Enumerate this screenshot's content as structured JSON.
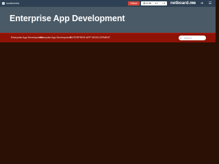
{
  "topbar": {
    "brand": "socialmedia",
    "follow_label": "Follow",
    "stats": {
      "views": "41.6k",
      "likes": "1",
      "shares": "4"
    },
    "site_brand": "netboard.me"
  },
  "header": {
    "title": "Enterprise App Development"
  },
  "nav": {
    "items": [
      {
        "label": "Enterprise App Development"
      },
      {
        "label": "Enterprise App Development"
      },
      {
        "label": "ENTERPRISE APP DEVELOPMENT"
      }
    ],
    "search_placeholder": "Search"
  },
  "colors": {
    "topbar": "#2e4154",
    "header": "#4a5a66",
    "navbar": "#8e1306",
    "body": "#2a1005",
    "follow": "#d4473a"
  }
}
